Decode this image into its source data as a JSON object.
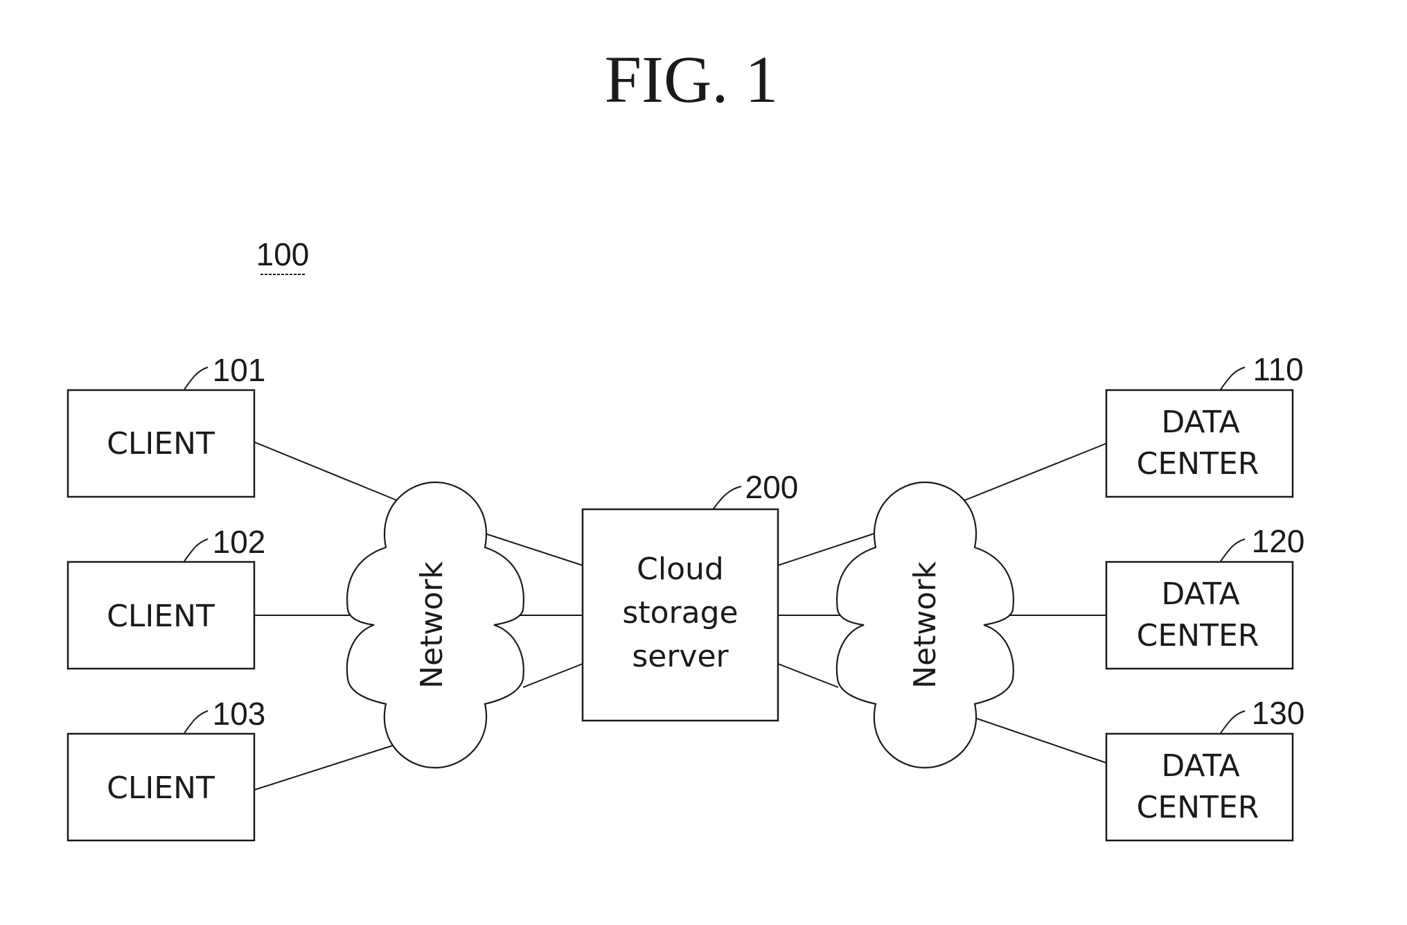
{
  "figure": {
    "title": "FIG. 1",
    "system_ref": "100"
  },
  "clients": [
    {
      "label": "CLIENT",
      "ref": "101"
    },
    {
      "label": "CLIENT",
      "ref": "102"
    },
    {
      "label": "CLIENT",
      "ref": "103"
    }
  ],
  "server": {
    "lines": [
      "Cloud",
      "storage",
      "server"
    ],
    "ref": "200"
  },
  "networks": [
    {
      "label": "Network"
    },
    {
      "label": "Network"
    }
  ],
  "data_centers": [
    {
      "lines": [
        "DATA",
        "CENTER"
      ],
      "ref": "110"
    },
    {
      "lines": [
        "DATA",
        "CENTER"
      ],
      "ref": "120"
    },
    {
      "lines": [
        "DATA",
        "CENTER"
      ],
      "ref": "130"
    }
  ]
}
